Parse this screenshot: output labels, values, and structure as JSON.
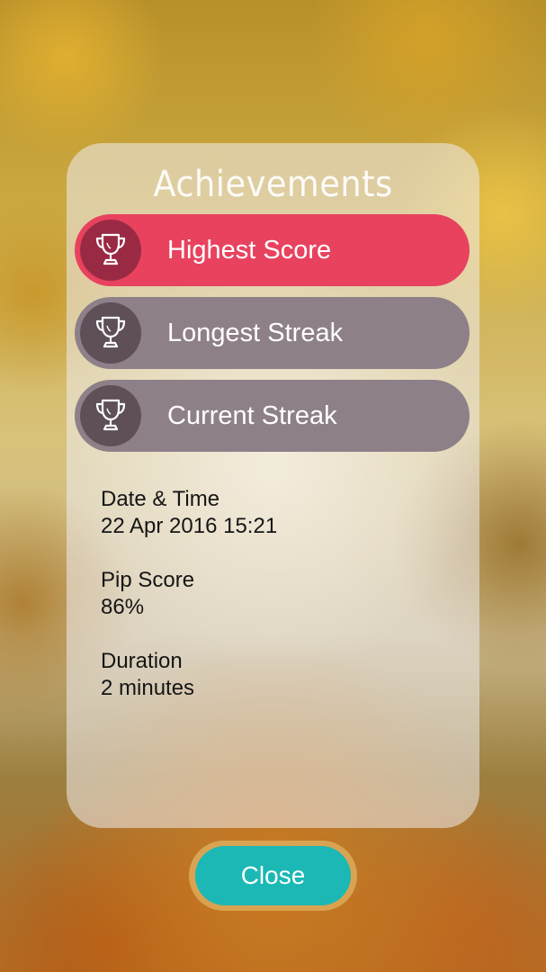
{
  "title": "Achievements",
  "achievements": [
    {
      "label": "Highest Score",
      "icon": "trophy-icon",
      "state": "selected"
    },
    {
      "label": "Longest Streak",
      "icon": "trophy-icon",
      "state": "default"
    },
    {
      "label": "Current Streak",
      "icon": "trophy-icon",
      "state": "default"
    }
  ],
  "details": [
    {
      "label": "Date & Time",
      "value": "22 Apr 2016 15:21"
    },
    {
      "label": "Pip Score",
      "value": "86%"
    },
    {
      "label": "Duration",
      "value": "2 minutes"
    }
  ],
  "close_label": "Close",
  "colors": {
    "selected": "#e8425f",
    "default": "#8e8088",
    "close": "#1bb8b5"
  }
}
